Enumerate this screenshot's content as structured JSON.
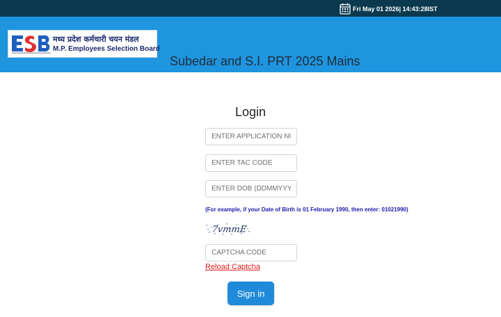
{
  "topbar": {
    "datetime": "Fri May 01 2026| 14:43:28IST",
    "icon": "calendar-icon"
  },
  "header": {
    "logo": {
      "abbr": "ESB",
      "hindi": "मध्य प्रदेश कर्मचारी चयन मंडल",
      "english": "M.P. Employees Selection Board"
    },
    "exam_title": "Subedar and S.I. PRT 2025 Mains"
  },
  "login": {
    "title": "Login",
    "application_placeholder": "ENTER APPLICATION NUMBER",
    "tac_placeholder": "ENTER TAC CODE",
    "dob_placeholder": "ENTER DOB (DDMMYYYY)",
    "dob_hint": "(For example, if your Date of Birth is 01 February 1990, then enter: 01021990)",
    "captcha_text": "7vmmE",
    "captcha_placeholder": "CAPTCHA CODE",
    "reload_label": "Reload Captcha",
    "signin_label": "Sign in"
  },
  "colors": {
    "topbar": "#0b3a4f",
    "header": "#1f95df",
    "hint": "#1a1aa8",
    "reload": "#e01b1b",
    "button": "#1f8ad9"
  }
}
